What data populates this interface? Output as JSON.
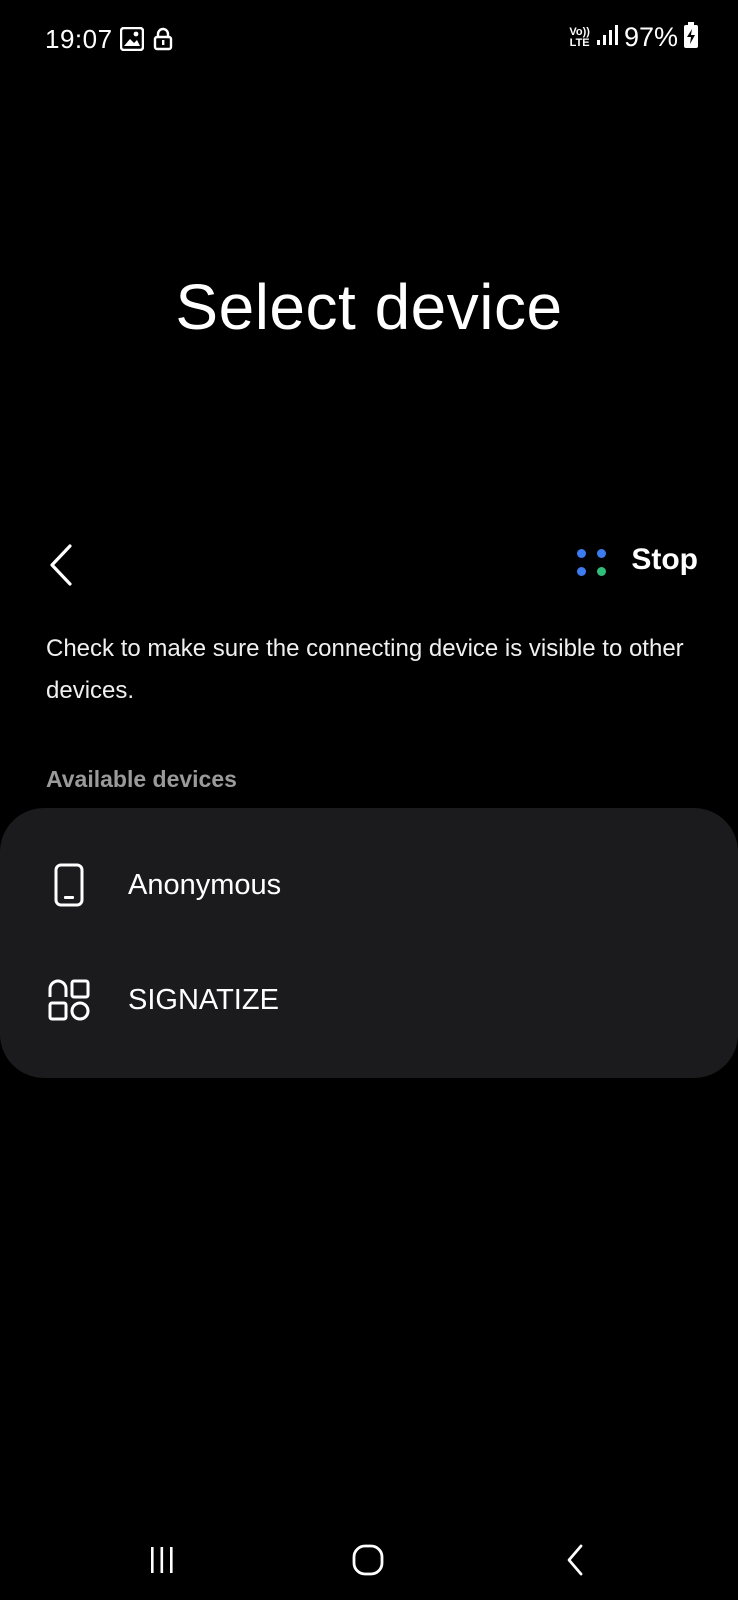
{
  "status_bar": {
    "time": "19:07",
    "network_label_top": "Vo))",
    "network_label_bottom": "LTE",
    "battery": "97%",
    "icons": [
      "image-icon",
      "lock-icon",
      "signal-icon",
      "battery-charging-icon"
    ]
  },
  "page": {
    "title": "Select device",
    "stop_label": "Stop",
    "description": "Check to make sure the connecting device is visible to other devices.",
    "section_header": "Available devices"
  },
  "devices": [
    {
      "name": "Anonymous",
      "icon": "phone-icon"
    },
    {
      "name": "SIGNATIZE",
      "icon": "apps-icon"
    }
  ],
  "colors": {
    "background": "#000000",
    "card": "#1b1b1d",
    "dot_blue": "#3d7cf0",
    "dot_green": "#2fbf7a",
    "section_header": "#9a9a9a"
  },
  "nav_bar": {
    "icons": [
      "recents-icon",
      "home-icon",
      "back-icon"
    ]
  }
}
